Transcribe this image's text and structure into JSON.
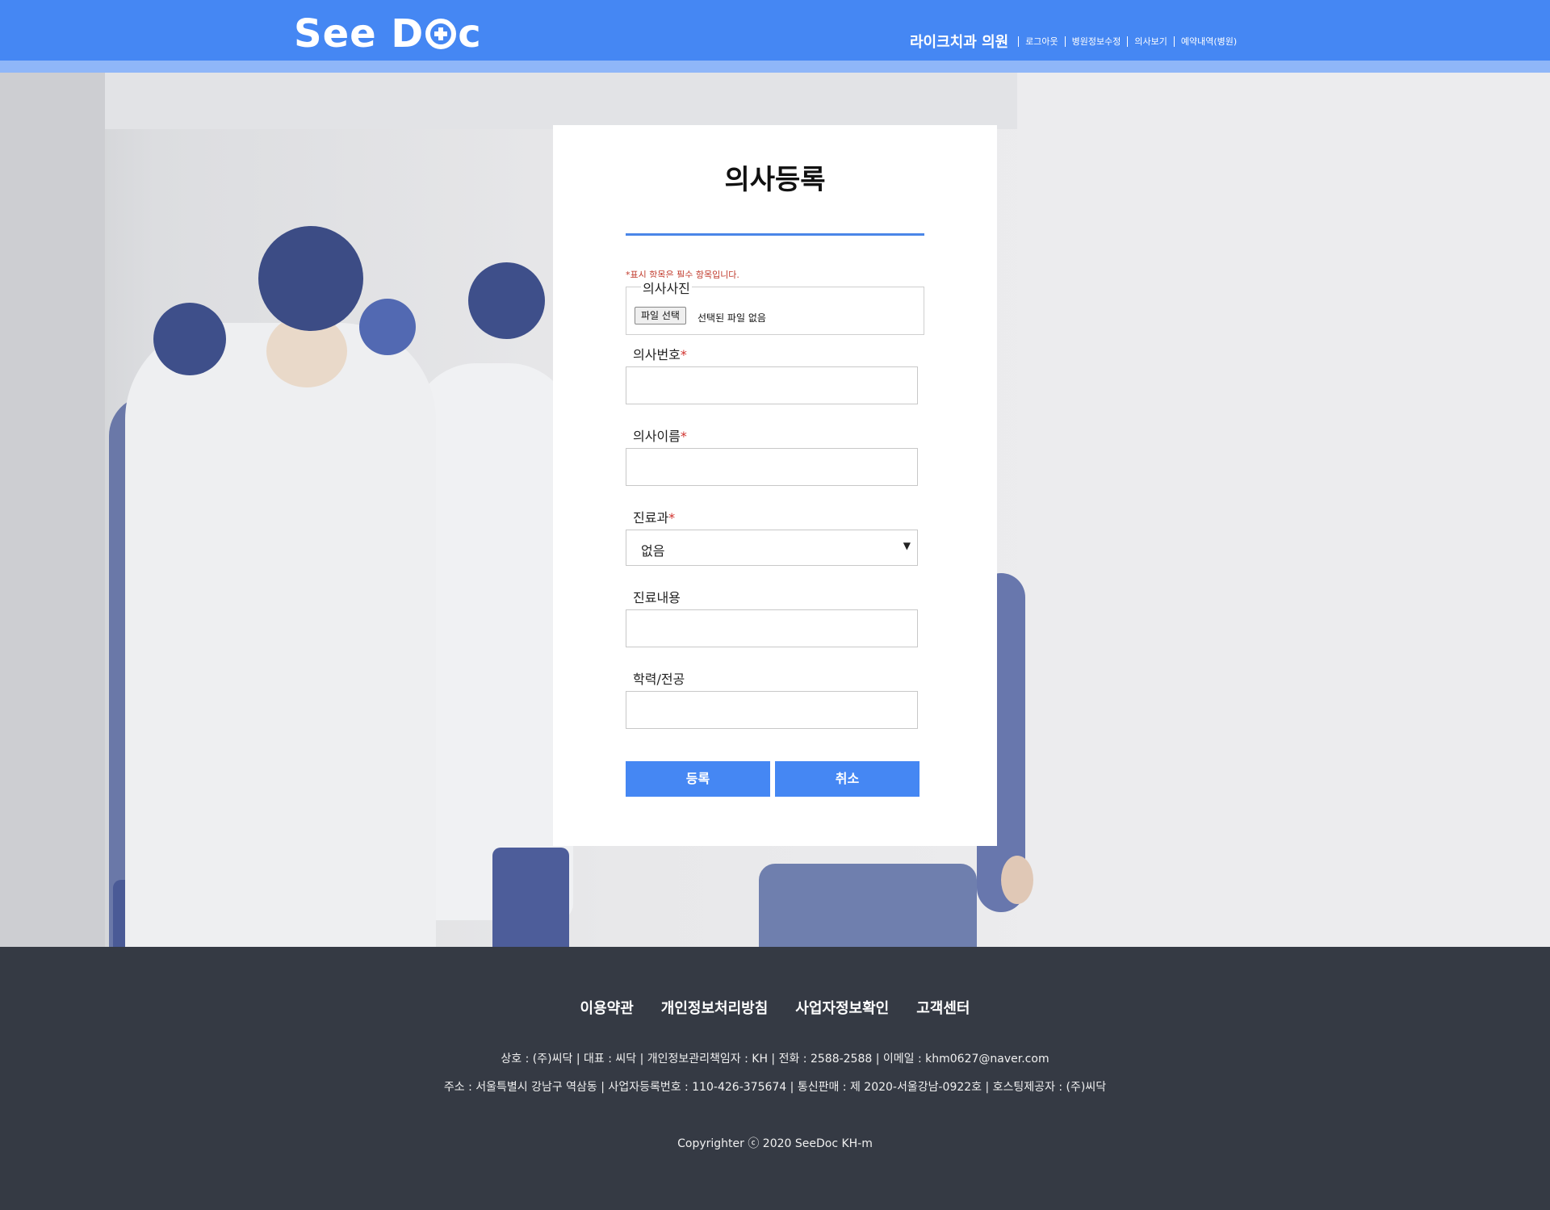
{
  "header": {
    "logo_text_1": "See D",
    "logo_text_2": "c",
    "clinic_name": "라이크치과 의원",
    "nav": [
      "로그아웃",
      "병원정보수정",
      "의사보기",
      "예약내역(병원)"
    ]
  },
  "form": {
    "title": "의사등록",
    "required_note": "*표시 항목은 필수 항목입니다.",
    "photo_legend": "의사사진",
    "file_button": "파일 선택",
    "file_status": "선택된 파일 없음",
    "doctor_number_label": "의사번호",
    "doctor_name_label": "의사이름",
    "department_label": "진료과",
    "department_value": "없음",
    "treatment_label": "진료내용",
    "education_label": "학력/전공",
    "required_mark": "*",
    "submit_label": "등록",
    "cancel_label": "취소"
  },
  "footer": {
    "links": [
      "이용약관",
      "개인정보처리방침",
      "사업자정보확인",
      "고객센터"
    ],
    "info_line_1": "상호 : (주)씨닥 | 대표 : 씨닥 | 개인정보관리책임자 : KH | 전화 : 2588-2588 | 이메일 : khm0627@naver.com",
    "info_line_2": "주소 : 서울특별시 강남구 역삼동 | 사업자등록번호 : 110-426-375674 | 통신판매 : 제 2020-서울강남-0922호 | 호스팅제공자 : (주)씨닥",
    "copyright": "Copyrighter ⓒ 2020 SeeDoc KH-m"
  },
  "colors": {
    "header_blue": "#4587f3",
    "header_strip": "#8fb6f8",
    "footer_bg": "#353a44",
    "required_red": "#d0312d"
  },
  "icons": {
    "logo_cross": "medical-cross-icon",
    "select_arrow": "chevron-down-icon"
  }
}
